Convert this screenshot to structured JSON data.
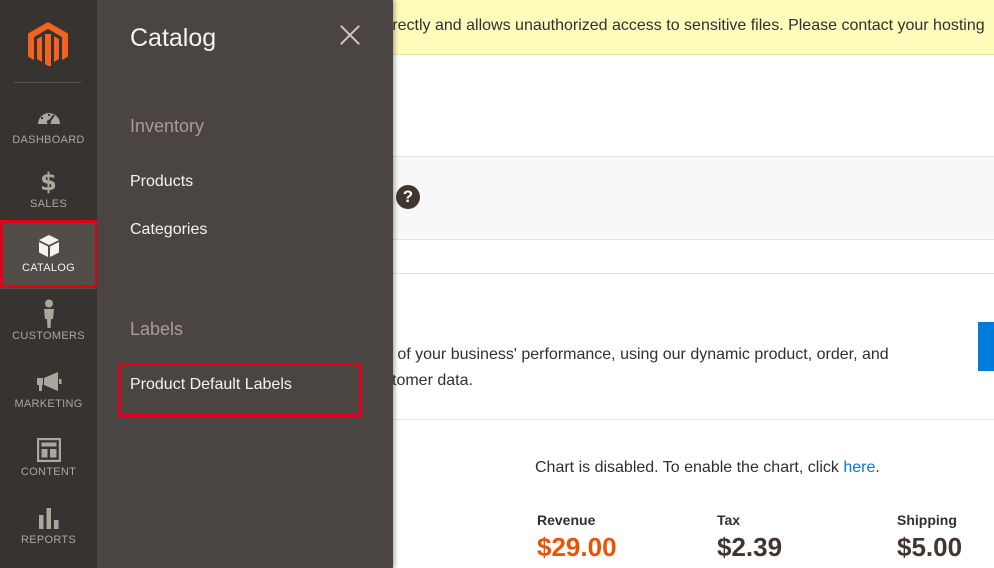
{
  "notice": {
    "text": "rrectly and allows unauthorized access to sensitive files. Please contact your hosting"
  },
  "nav": {
    "items": [
      {
        "id": "dashboard",
        "label": "DASHBOARD",
        "icon": "dashboard-icon"
      },
      {
        "id": "sales",
        "label": "SALES",
        "icon": "dollar-icon"
      },
      {
        "id": "catalog",
        "label": "CATALOG",
        "icon": "box-icon",
        "active": true
      },
      {
        "id": "customers",
        "label": "CUSTOMERS",
        "icon": "person-icon"
      },
      {
        "id": "marketing",
        "label": "MARKETING",
        "icon": "megaphone-icon"
      },
      {
        "id": "content",
        "label": "CONTENT",
        "icon": "layout-icon"
      },
      {
        "id": "reports",
        "label": "REPORTS",
        "icon": "bar-chart-icon"
      }
    ]
  },
  "flyout": {
    "title": "Catalog",
    "group_inventory": "Inventory",
    "link_products": "Products",
    "link_categories": "Categories",
    "group_labels": "Labels",
    "link_product_default_labels": "Product Default Labels"
  },
  "page": {
    "intro_line1": "d of your business' performance, using our dynamic product, order, and",
    "intro_line2": "stomer data.",
    "chart_msg_prefix": "Chart is disabled. To enable the chart, click ",
    "chart_msg_link": "here",
    "chart_msg_suffix": ".",
    "help_glyph": "?",
    "stats": [
      {
        "label": "Revenue",
        "value": "$29.00"
      },
      {
        "label": "Tax",
        "value": "$2.39"
      },
      {
        "label": "Shipping",
        "value": "$5.00"
      }
    ]
  },
  "colors": {
    "nav_bg": "#373330",
    "flyout_bg": "#4a4542",
    "highlight": "#e0001a",
    "revenue": "#eb5202",
    "link": "#007bdb",
    "notice_bg": "#fffbbb"
  }
}
